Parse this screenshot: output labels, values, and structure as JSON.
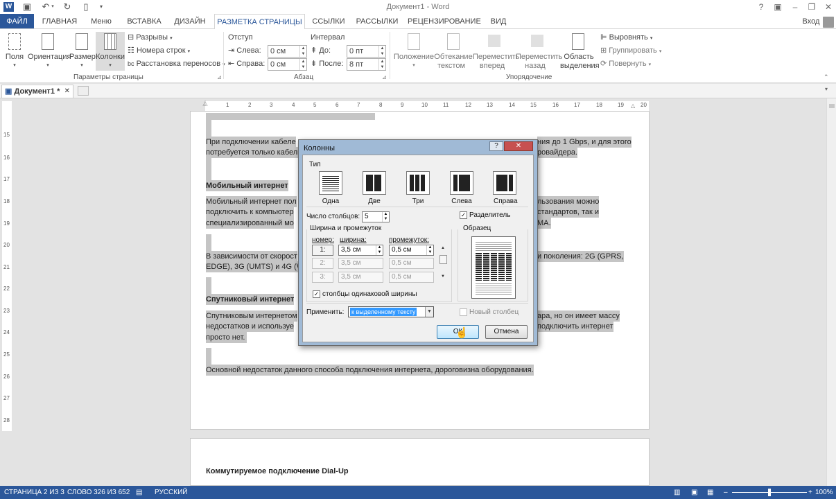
{
  "window": {
    "title": "Документ1 - Word",
    "signin": "Вход"
  },
  "tabs": [
    "ФАЙЛ",
    "ГЛАВНАЯ",
    "Меню",
    "ВСТАВКА",
    "ДИЗАЙН",
    "РАЗМЕТКА СТРАНИЦЫ",
    "ССЫЛКИ",
    "РАССЫЛКИ",
    "РЕЦЕНЗИРОВАНИЕ",
    "ВИД"
  ],
  "ribbon": {
    "page_setup": {
      "fields": "Поля",
      "orientation": "Ориентация",
      "size": "Размер",
      "columns": "Колонки",
      "breaks": "Разрывы",
      "line_numbers": "Номера строк",
      "hyphenation": "Расстановка переносов",
      "group_label": "Параметры страницы"
    },
    "paragraph": {
      "indent_label": "Отступ",
      "left_label": "Слева:",
      "left_value": "0 см",
      "right_label": "Справа:",
      "right_value": "0 см",
      "spacing_label": "Интервал",
      "before_label": "До:",
      "before_value": "0 пт",
      "after_label": "После:",
      "after_value": "8 пт",
      "group_label": "Абзац"
    },
    "arrange": {
      "position": "Положение",
      "wrap_1": "Обтекание",
      "wrap_2": "текстом",
      "forward_1": "Переместить",
      "forward_2": "вперед",
      "backward_1": "Переместить",
      "backward_2": "назад",
      "pane_1": "Область",
      "pane_2": "выделения",
      "align": "Выровнять",
      "group": "Группировать",
      "rotate": "Повернуть",
      "group_label": "Упорядочение"
    }
  },
  "doctab": {
    "name": "Документ1 *"
  },
  "ruler": {
    "h_ticks": [
      "1",
      "2",
      "3",
      "4",
      "5",
      "6",
      "7",
      "8",
      "9",
      "10",
      "11",
      "12",
      "13",
      "14",
      "15",
      "16",
      "17",
      "18",
      "19",
      "20"
    ],
    "v_ticks": [
      "15",
      "16",
      "17",
      "18",
      "19",
      "20",
      "21",
      "22",
      "23",
      "24",
      "25",
      "26",
      "27",
      "28"
    ]
  },
  "document": {
    "p1a": "При подключении кабеле",
    "p1b": "ния до 1 Gbps, и для этого",
    "p2a": "потребуется только кабель",
    "p2b": "ровайдера.",
    "h_mobile": "Мобильный интернет",
    "m1a": "Мобильный интернет пол",
    "m1b": "льзования можно",
    "m2a": "подключить к компьютер",
    "m2b": "стандартов, так и",
    "m3a": "специализированный мо",
    "m3b": "МА.",
    "s1a": "В зависимости от скорост",
    "s1b": "и поколения: 2G (GPRS,",
    "s2a": "EDGE), 3G (UMTS) и 4G (W",
    "h_sat": "Спутниковый интернет",
    "t1a": "Спутниковым интернетом",
    "t1b": "ара, но он имеет массу",
    "t2a": "недостатков и используе",
    "t2b": "подключить интернет",
    "t3": "просто нет.",
    "last": "Основной недостаток данного способа подключения интернета, дороговизна оборудования.",
    "page2_heading": "Коммутируемое подключение Dial-Up"
  },
  "dialog": {
    "title": "Колонны",
    "help": "?",
    "close": "✕",
    "type_label": "Тип",
    "presets": [
      "Одна",
      "Две",
      "Три",
      "Слева",
      "Справа"
    ],
    "num_cols_label": "Число столбцов:",
    "num_cols_value": "5",
    "separator_label": "Разделитель",
    "width_spacing_label": "Ширина и промежуток",
    "col_num_header": "номер:",
    "col_width_header": "ширина:",
    "col_gap_header": "промежуток:",
    "rows": [
      {
        "num": "1:",
        "width": "3,5 см",
        "gap": "0,5 см"
      },
      {
        "num": "2:",
        "width": "3,5 см",
        "gap": "0,5 см"
      },
      {
        "num": "3:",
        "width": "3,5 см",
        "gap": "0,5 см"
      }
    ],
    "preview_label": "Образец",
    "equal_width_label": "столбцы одинаковой ширины",
    "apply_label": "Применить:",
    "apply_value": "к выделенному тексту",
    "new_column_label": "Новый столбец",
    "ok": "ОК",
    "cancel": "Отмена"
  },
  "status": {
    "page": "СТРАНИЦА 2 ИЗ 3",
    "words": "СЛОВО 326 ИЗ 652",
    "lang": "РУССКИЙ",
    "zoom": "100%"
  },
  "colors": {
    "accent": "#2b579a",
    "selection": "#c5c5c5"
  }
}
